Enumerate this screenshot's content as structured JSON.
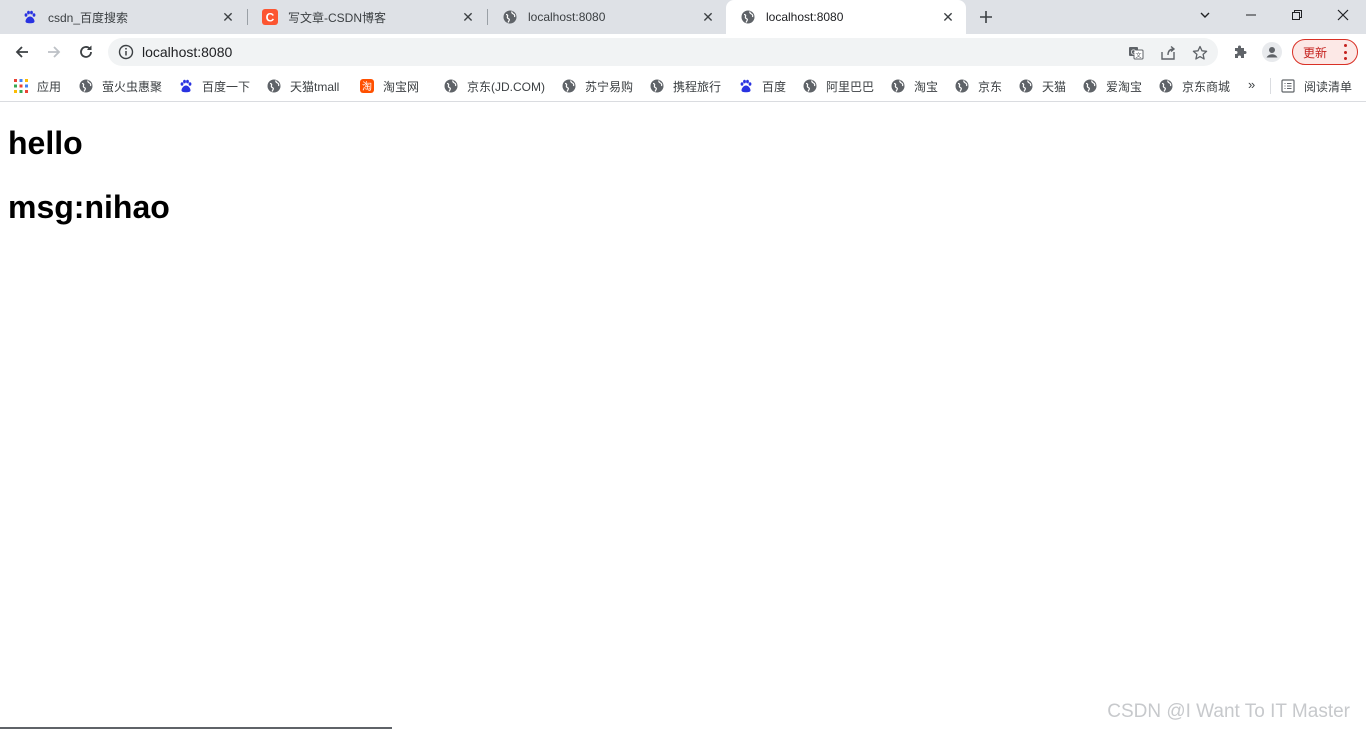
{
  "tabs": [
    {
      "title": "csdn_百度搜索",
      "icon": "baidu-paw-icon",
      "active": false
    },
    {
      "title": "写文章-CSDN博客",
      "icon": "csdn-logo-icon",
      "active": false
    },
    {
      "title": "localhost:8080",
      "icon": "globe-icon",
      "active": false
    },
    {
      "title": "localhost:8080",
      "icon": "globe-icon",
      "active": true
    }
  ],
  "toolbar": {
    "url": "localhost:8080",
    "update_label": "更新"
  },
  "bookmarks": {
    "items": [
      {
        "label": "应用",
        "icon": "apps-grid-icon"
      },
      {
        "label": "萤火虫惠聚",
        "icon": "globe-icon"
      },
      {
        "label": "百度一下",
        "icon": "baidu-paw-icon"
      },
      {
        "label": "天猫tmall",
        "icon": "globe-icon"
      },
      {
        "label": "淘宝网",
        "icon": "taobao-icon"
      },
      {
        "label": "京东(JD.COM)",
        "icon": "globe-icon"
      },
      {
        "label": "苏宁易购",
        "icon": "globe-icon"
      },
      {
        "label": "携程旅行",
        "icon": "globe-icon"
      },
      {
        "label": "百度",
        "icon": "baidu-paw-icon"
      },
      {
        "label": "阿里巴巴",
        "icon": "globe-icon"
      },
      {
        "label": "淘宝",
        "icon": "globe-icon"
      },
      {
        "label": "京东",
        "icon": "globe-icon"
      },
      {
        "label": "天猫",
        "icon": "globe-icon"
      },
      {
        "label": "爱淘宝",
        "icon": "globe-icon"
      },
      {
        "label": "京东商城",
        "icon": "globe-icon"
      }
    ],
    "more_label": "»",
    "reading_list_label": "阅读清单"
  },
  "page": {
    "heading1": "hello",
    "heading2": "msg:nihao"
  },
  "watermark": "CSDN @I Want To IT Master",
  "colors": {
    "tabstrip_bg": "#dee1e6",
    "omnibox_bg": "#f1f3f4",
    "update_red": "#d93025",
    "csdn_red": "#fc5531",
    "baidu_blue": "#2932e1"
  }
}
